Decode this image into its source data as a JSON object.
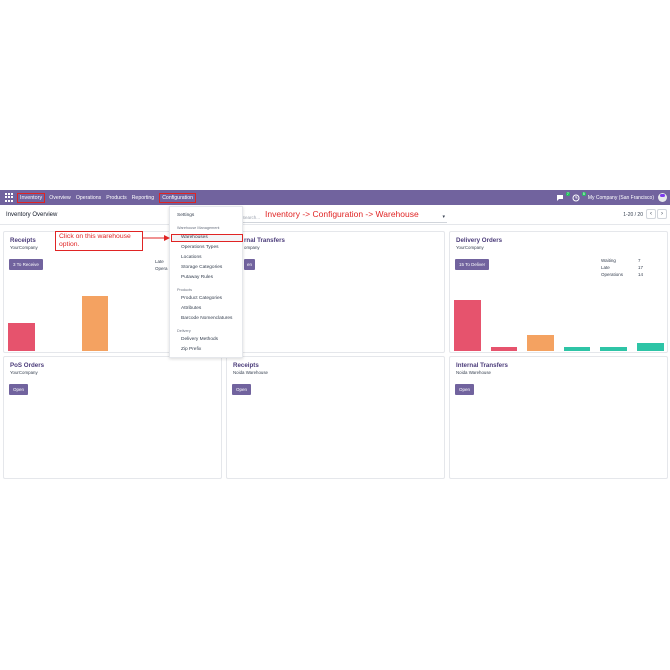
{
  "navbar": {
    "brand": "Inventory",
    "items": [
      "Overview",
      "Operations",
      "Products",
      "Reporting"
    ],
    "configuration": "Configuration",
    "chat_badge": "7",
    "activity_badge": "5",
    "company": "My Company (San Francisco)"
  },
  "subheader": {
    "title": "Inventory Overview",
    "search_placeholder": "Search...",
    "annotation": "Inventory -> Configuration -> Warehouse",
    "pager": "1-20 / 20"
  },
  "dropdown": {
    "settings": "Settings",
    "section_warehouse": "Warehouse Management",
    "warehouses": "Warehouses",
    "operations_types": "Operations Types",
    "locations": "Locations",
    "storage_categories": "Storage Categories",
    "putaway_rules": "Putaway Rules",
    "section_products": "Products",
    "product_categories": "Product Categories",
    "attributes": "Attributes",
    "barcode_nomenclatures": "Barcode Nomenclatures",
    "section_delivery": "Delivery",
    "delivery_methods": "Delivery Methods",
    "zip_prefix": "Zip Prefix"
  },
  "callout": {
    "text": "Click on this warehouse option."
  },
  "cards": {
    "receipts": {
      "title": "Receipts",
      "company": "YourCompany",
      "button": "3 To Receive",
      "late": "Late",
      "operations": "Opera"
    },
    "internal": {
      "title": "rnal Transfers",
      "company": "ompany",
      "button": "en"
    },
    "delivery": {
      "title": "Delivery Orders",
      "company": "YourCompany",
      "button": "15 To Deliver",
      "stats": [
        {
          "label": "Waiting",
          "value": "7"
        },
        {
          "label": "Late",
          "value": "17"
        },
        {
          "label": "Operations",
          "value": "14"
        }
      ]
    },
    "pos": {
      "title": "PoS Orders",
      "company": "YourCompany",
      "button": "Open"
    },
    "receipts_noida": {
      "title": "Receipts",
      "company": "Noida Warehouse",
      "button": "Open"
    },
    "internal_noida": {
      "title": "Internal Transfers",
      "company": "Noida Warehouse",
      "button": "Open"
    }
  },
  "colors": {
    "navbar": "#71639e",
    "accent": "#e02424",
    "bar_red": "#e6536d",
    "bar_orange": "#f4a261",
    "bar_teal": "#2ec4a6"
  }
}
